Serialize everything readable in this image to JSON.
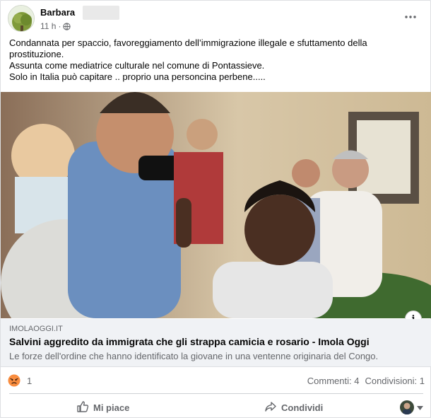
{
  "post": {
    "author": "Barbara",
    "time": "11 h",
    "separator": "·",
    "text_lines": [
      "Condannata per spaccio, favoreggiamento dell’immigrazione illegale e sfuttamento della",
      "prostituzione.",
      "Assunta come mediatrice culturale nel comune di Pontassieve.",
      "Solo in Italia può capitare .. proprio una personcina perbene....."
    ]
  },
  "link": {
    "domain": "IMOLAOGGI.IT",
    "title": "Salvini aggredito da immigrata che gli strappa camicia e rosario - Imola Oggi",
    "description": "Le forze dell'ordine che hanno identificato la giovane in una ventenne originaria del Congo.",
    "info_label": "i"
  },
  "stats": {
    "reactions_count": "1",
    "comments": "Commenti: 4",
    "shares": "Condivisioni: 1"
  },
  "actions": {
    "like": "Mi piace",
    "share": "Condividi"
  },
  "colors": {
    "angry_reaction": "#f7714a",
    "secondary_text": "#65676b",
    "link_bg": "#f0f2f5"
  },
  "icons": [
    "globe-icon",
    "more-options-icon",
    "angry-reaction-icon",
    "like-icon",
    "share-icon",
    "chevron-down-icon",
    "info-icon"
  ]
}
